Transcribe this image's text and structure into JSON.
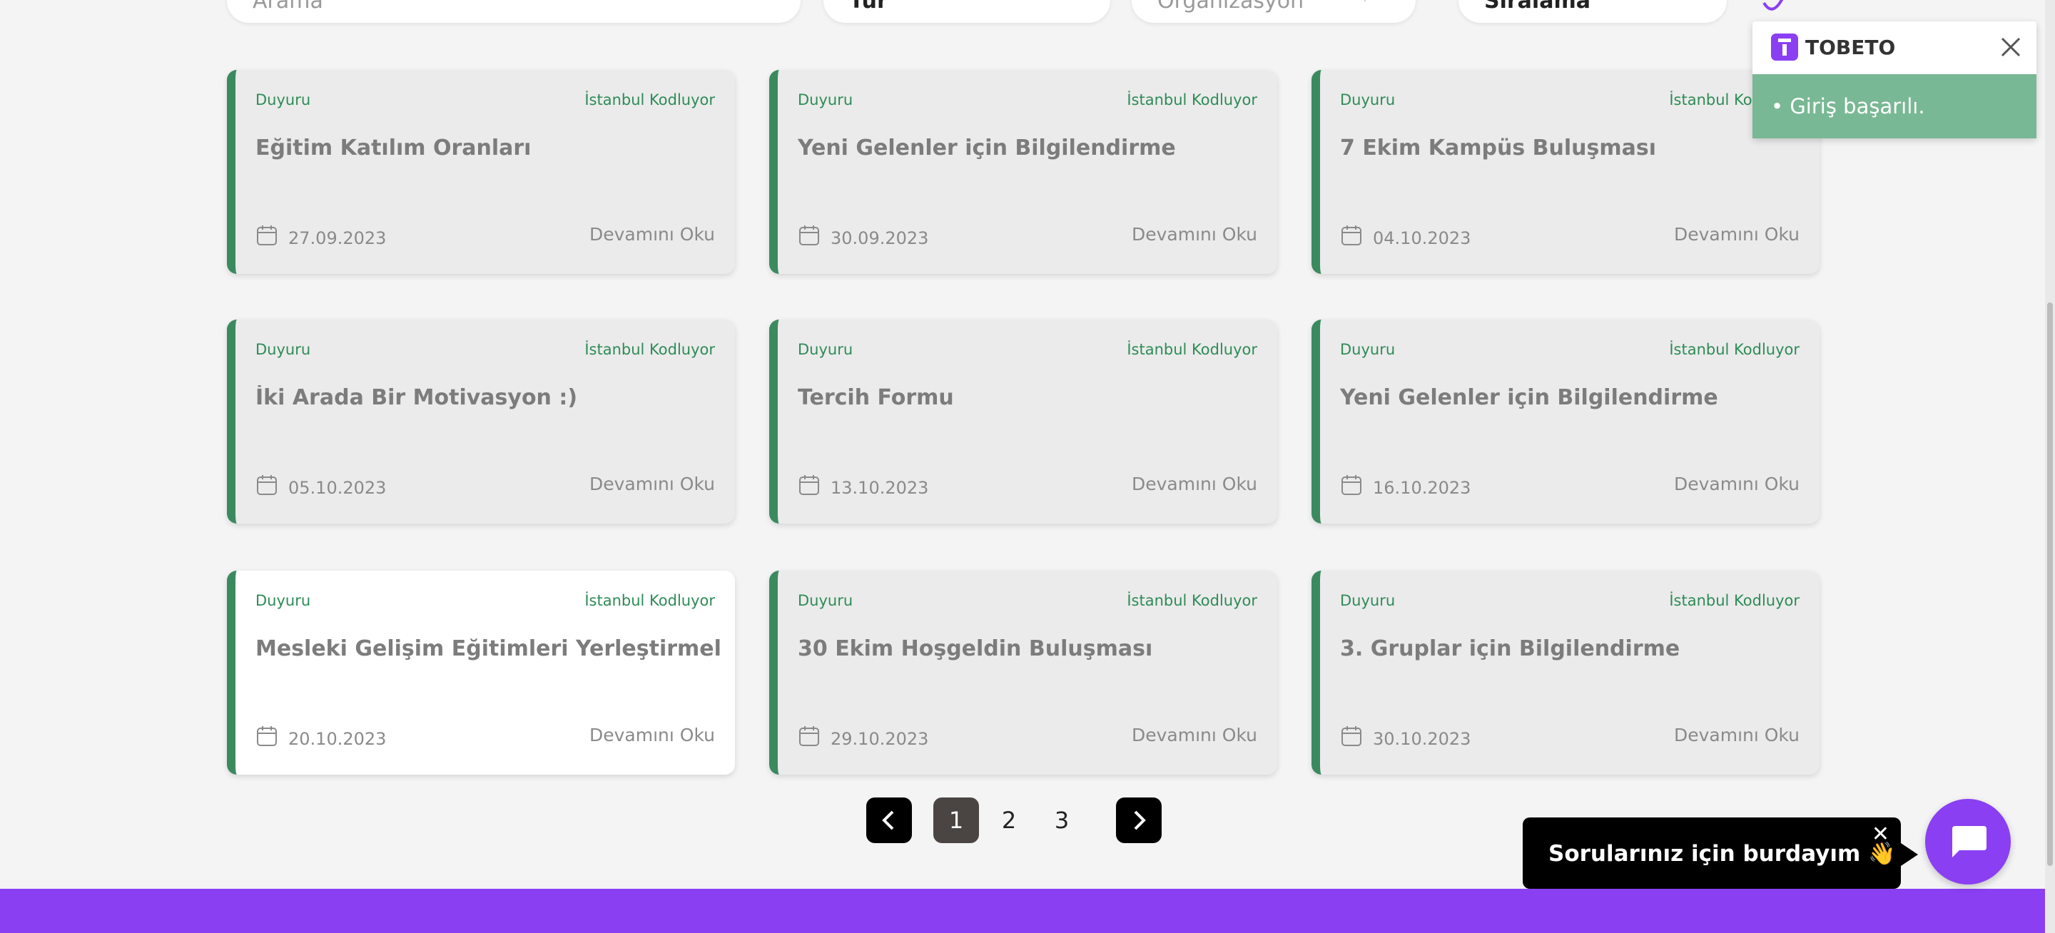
{
  "filters": {
    "search_placeholder": "Arama",
    "type_value": "Tür",
    "organization_placeholder": "Organizasyon",
    "sort_value": "Sıralama"
  },
  "cards": [
    {
      "category": "Duyuru",
      "organization": "İstanbul Kodluyor",
      "title": "Eğitim Katılım Oranları",
      "date": "27.09.2023",
      "more": "Devamını Oku"
    },
    {
      "category": "Duyuru",
      "organization": "İstanbul Kodluyor",
      "title": "Yeni Gelenler için Bilgilendirme",
      "date": "30.09.2023",
      "more": "Devamını Oku"
    },
    {
      "category": "Duyuru",
      "organization": "İstanbul Kodluyor",
      "title": "7 Ekim Kampüs Buluşması",
      "date": "04.10.2023",
      "more": "Devamını Oku"
    },
    {
      "category": "Duyuru",
      "organization": "İstanbul Kodluyor",
      "title": "İki Arada Bir Motivasyon :)",
      "date": "05.10.2023",
      "more": "Devamını Oku"
    },
    {
      "category": "Duyuru",
      "organization": "İstanbul Kodluyor",
      "title": "Tercih Formu",
      "date": "13.10.2023",
      "more": "Devamını Oku"
    },
    {
      "category": "Duyuru",
      "organization": "İstanbul Kodluyor",
      "title": "Yeni Gelenler için Bilgilendirme",
      "date": "16.10.2023",
      "more": "Devamını Oku"
    },
    {
      "category": "Duyuru",
      "organization": "İstanbul Kodluyor",
      "title": "Mesleki Gelişim Eğitimleri Yerleştirmeleri Hk.",
      "date": "20.10.2023",
      "more": "Devamını Oku"
    },
    {
      "category": "Duyuru",
      "organization": "İstanbul Kodluyor",
      "title": "30 Ekim Hoşgeldin Buluşması",
      "date": "29.10.2023",
      "more": "Devamını Oku"
    },
    {
      "category": "Duyuru",
      "organization": "İstanbul Kodluyor",
      "title": "3. Gruplar için Bilgilendirme",
      "date": "30.10.2023",
      "more": "Devamını Oku"
    }
  ],
  "pagination": {
    "pages": [
      "1",
      "2",
      "3"
    ],
    "active": "1"
  },
  "toast": {
    "brand": "TOBETO",
    "message": "• Giriş başarılı."
  },
  "chat": {
    "message": "Sorularınız için burdayım 👋",
    "close": "✕"
  },
  "colors": {
    "accent": "#8a3ff2",
    "card_border": "#3b8a5f",
    "toast_body": "#79b894"
  }
}
